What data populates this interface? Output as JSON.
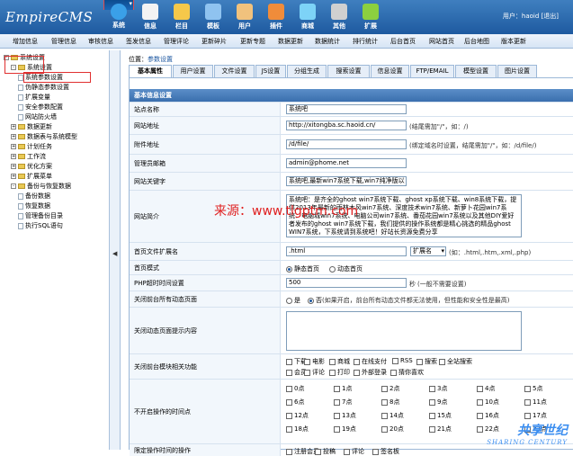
{
  "app": {
    "logo": "EmpireCMS"
  },
  "topnav": [
    {
      "label": "系统",
      "icon": "globe-icon",
      "color": "#3aa0e8"
    },
    {
      "label": "信息",
      "icon": "doc-icon",
      "color": "#f3f3f3"
    },
    {
      "label": "栏目",
      "icon": "folder-icon",
      "color": "#f5c84a"
    },
    {
      "label": "模板",
      "icon": "template-icon",
      "color": "#8fc3f0"
    },
    {
      "label": "用户",
      "icon": "user-icon",
      "color": "#f1c27d"
    },
    {
      "label": "插件",
      "icon": "tool-icon",
      "color": "#f08c3a"
    },
    {
      "label": "商城",
      "icon": "shop-icon",
      "color": "#7dd3f7"
    },
    {
      "label": "其他",
      "icon": "gear-icon",
      "color": "#d0d0d0"
    },
    {
      "label": "扩展",
      "icon": "plus-icon",
      "color": "#8ccf3f"
    }
  ],
  "user": {
    "prefix": "用户：",
    "name": "haoid",
    "logout": "[退出]"
  },
  "menubar": [
    "增加信息",
    "管理信息",
    "审核信息",
    "签发信息",
    "管理评论",
    "更新碎片",
    "更新专题",
    "数据更新",
    "数据统计",
    "排行统计",
    "后台首页",
    "网站首页",
    "后台地图",
    "版本更新"
  ],
  "sidebar": {
    "items": [
      {
        "label": "系统设置",
        "level": 0,
        "box": "-",
        "icon": "folder"
      },
      {
        "label": "系统设置",
        "level": 1,
        "box": "-",
        "icon": "folder"
      },
      {
        "label": "系统参数设置",
        "level": 2,
        "icon": "doc"
      },
      {
        "label": "伪静态参数设置",
        "level": 2,
        "icon": "doc"
      },
      {
        "label": "扩展变量",
        "level": 2,
        "icon": "doc"
      },
      {
        "label": "安全参数配置",
        "level": 2,
        "icon": "doc"
      },
      {
        "label": "网站防火墙",
        "level": 2,
        "icon": "doc"
      },
      {
        "label": "数据更新",
        "level": 1,
        "box": "+",
        "icon": "folder"
      },
      {
        "label": "数据表与系统模型",
        "level": 1,
        "box": "+",
        "icon": "folder"
      },
      {
        "label": "计划任务",
        "level": 1,
        "box": "+",
        "icon": "folder"
      },
      {
        "label": "工作流",
        "level": 1,
        "box": "+",
        "icon": "folder"
      },
      {
        "label": "优化方案",
        "level": 1,
        "box": "+",
        "icon": "folder"
      },
      {
        "label": "扩展菜单",
        "level": 1,
        "box": "+",
        "icon": "folder"
      },
      {
        "label": "备份与恢复数据",
        "level": 1,
        "box": "-",
        "icon": "folder"
      },
      {
        "label": "备份数据",
        "level": 2,
        "icon": "doc"
      },
      {
        "label": "恢复数据",
        "level": 2,
        "icon": "doc"
      },
      {
        "label": "管理备份目录",
        "level": 2,
        "icon": "doc"
      },
      {
        "label": "执行SQL语句",
        "level": 2,
        "icon": "doc"
      }
    ]
  },
  "breadcrumb": {
    "prefix": "位置：",
    "link": "参数设置"
  },
  "tabs": [
    "基本属性",
    "用户设置",
    "文件设置",
    "JS设置",
    "分组生成",
    "搜索设置",
    "信息设置",
    "FTP/EMAIL",
    "模型设置",
    "图片设置"
  ],
  "panel": {
    "title": "基本信息设置"
  },
  "form": {
    "site_name": {
      "label": "站点名称",
      "value": "系统吧"
    },
    "site_url": {
      "label": "网站地址",
      "value": "http://xitongba.sc.haoid.cn/",
      "hint": "(结尾需加\"/\"，如：/)"
    },
    "attach_url": {
      "label": "附件地址",
      "value": "/d/file/",
      "hint": "(绑定域名时设置，结尾需加\"/\"，如：/d/file/)"
    },
    "admin_email": {
      "label": "管理员邮箱",
      "value": "admin@phome.net"
    },
    "keywords": {
      "label": "网站关键字",
      "value": "系统吧,最新win7系统下载,win7纯净版以"
    },
    "intro": {
      "label": "网站简介",
      "value": "系统吧：是齐全的ghost win7系统下载、ghost xp系统下载、win8系统下载，提供2013年最新的雨林木风win7系统、深度技术win7系统、新萝卜花园win7系统、电脑城win7系统、电脑公司win7系统、番茄花园win7系统以及其他DIY爱好者发布的ghost win7系统下载，我们提供的操作系统都是精心挑选的精品ghost WIN7系统，下系统请到系统吧！好站长资源免费分享"
    },
    "index_ext": {
      "label": "首页文件扩展名",
      "value": ".html",
      "select": "扩展名",
      "hint": "(如：.html,.htm,.xml,.php)"
    },
    "index_mode": {
      "label": "首页模式",
      "opt1": "静态首页",
      "opt2": "动态首页"
    },
    "php_timeout": {
      "label": "PHP超时时间设置",
      "value": "500",
      "unit": "秒",
      "hint": "(一般不需要设置)"
    },
    "close_dynamic": {
      "label": "关闭前台所有动态页面",
      "opt_yes": "是",
      "opt_no": "否",
      "hint": "(如果开启，前台所有动态文件都无法使用，但性能和安全性是最高)"
    },
    "close_tip": {
      "label": "关闭动态页面提示内容",
      "value": ""
    },
    "close_modules": {
      "label": "关闭前台模块相关功能",
      "row1": [
        "下载",
        "电影",
        "商城",
        "在线支付",
        "RSS",
        "搜索",
        "全站搜索"
      ],
      "row2": [
        "会员",
        "评论",
        "打印",
        "外部登录",
        "猜你喜欢"
      ]
    },
    "no_op_hours": {
      "label": "不开启操作的时间点",
      "hours": [
        "0点",
        "1点",
        "2点",
        "3点",
        "4点",
        "5点",
        "6点",
        "7点",
        "8点",
        "9点",
        "10点",
        "11点",
        "12点",
        "13点",
        "14点",
        "15点",
        "16点",
        "17点",
        "18点",
        "19点",
        "20点",
        "21点",
        "22点",
        "23点"
      ]
    },
    "last_row": {
      "label": "限定操作时间的操作",
      "items": [
        "注册会员",
        "投稿",
        "评论",
        "签名板"
      ]
    }
  },
  "watermarks": {
    "center": "来源：www.tlgptm.com",
    "corner_cn": "共享世纪",
    "corner_en": "SHARING CENTURY"
  }
}
